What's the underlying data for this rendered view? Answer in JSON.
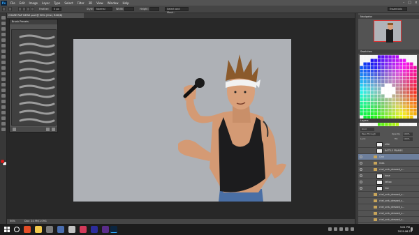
{
  "app": {
    "logo": "Ps",
    "title": "Photoshop"
  },
  "menu": [
    "File",
    "Edit",
    "Image",
    "Layer",
    "Type",
    "Select",
    "Filter",
    "3D",
    "View",
    "Window",
    "Help"
  ],
  "window_controls": [
    "-",
    "□",
    "×"
  ],
  "options_bar": {
    "feather_label": "Feather:",
    "feather_value": "0 px",
    "style_label": "Style:",
    "style_value": "Normal",
    "width_label": "Width:",
    "height_label": "Height:",
    "select_mask_label": "Select and Mask...",
    "workspace_value": "Essentials"
  },
  "document": {
    "tab_title": "CHARE RAP NEW1.psd @ 50% (Chel, RGB/8)",
    "zoom": "50%",
    "doc_size": "Doc: 24.9M/1.09G"
  },
  "brush_panel": {
    "title": "Brush Presets",
    "icons": [
      "brush-preset-icon",
      "brush-settings-icon",
      "new-brush-icon",
      "delete-brush-icon"
    ]
  },
  "navigator": {
    "title": "Navigator"
  },
  "swatches": {
    "title": "Swatches"
  },
  "layers": {
    "title": "Layers",
    "filter_kind": "Kind",
    "blend_mode": "Pass Through",
    "opacity_label": "Opacity:",
    "opacity_value": "100%",
    "lock_label": "Lock:",
    "fill_label": "Fill:",
    "fill_value": "100%",
    "items": [
      {
        "name": "elite",
        "type": "layer",
        "visible": false
      },
      {
        "name": "BATTLE FRAMES",
        "type": "layer",
        "visible": false
      },
      {
        "name": "Chel",
        "type": "folder",
        "visible": true,
        "selected": true
      },
      {
        "name": "lines",
        "type": "folder",
        "visible": true
      },
      {
        "name": "chel_urdu_dressed_s...",
        "type": "folder",
        "visible": true
      },
      {
        "name": "base",
        "type": "layer",
        "visible": true
      },
      {
        "name": "tattoo",
        "type": "layer",
        "visible": true
      },
      {
        "name": "line",
        "type": "layer",
        "visible": true
      },
      {
        "name": "chel_urdu_dressed_s...",
        "type": "folder",
        "visible": false
      },
      {
        "name": "chel_urdu_dressed_s...",
        "type": "folder",
        "visible": false
      },
      {
        "name": "chel_urdu_dressed_s...",
        "type": "folder",
        "visible": false
      },
      {
        "name": "chel_urdu_dressed_s...",
        "type": "folder",
        "visible": false
      },
      {
        "name": "chel_urdu_dressed_s...",
        "type": "folder",
        "visible": false
      }
    ]
  },
  "taskbar": {
    "clock_time": "3:01 PM",
    "clock_date": "2019-06-29"
  },
  "colors": {
    "accent": "#31a8ff",
    "canvas_bg": "#aeb1b6",
    "panel_bg": "#535353",
    "workspace_bg": "#282828"
  }
}
